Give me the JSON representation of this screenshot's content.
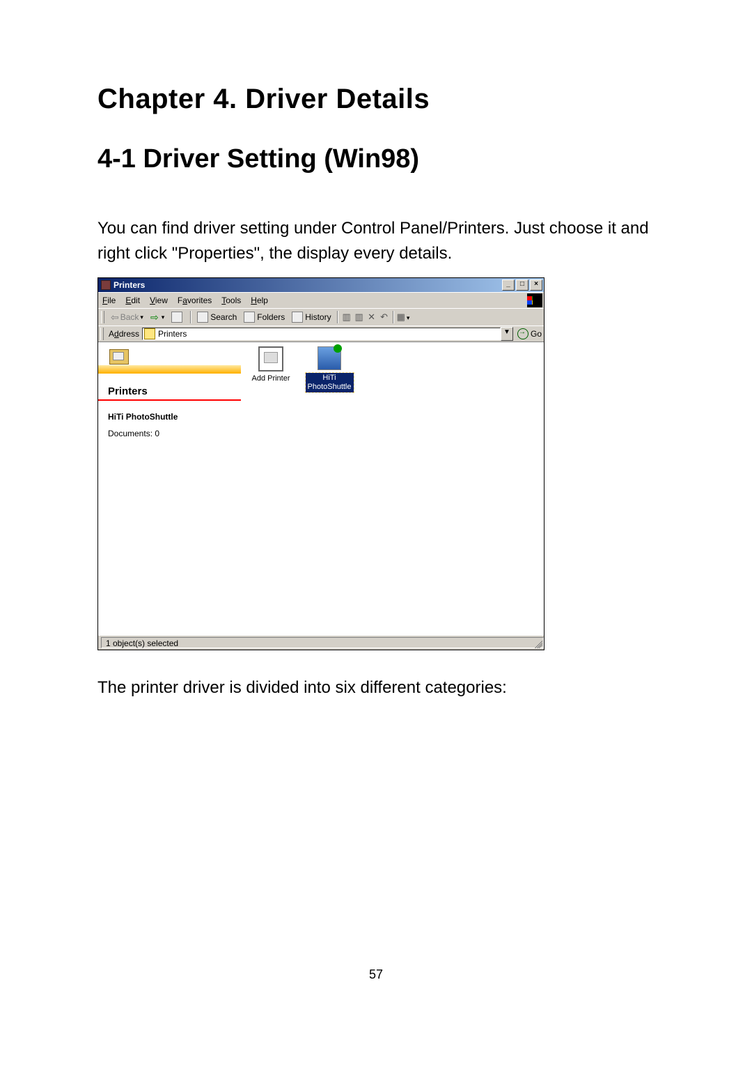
{
  "document": {
    "chapter_heading": "Chapter 4.    Driver Details",
    "section_heading": "4-1  Driver Setting (Win98)",
    "intro_text": "You can find driver setting under Control Panel/Printers. Just choose it and right click \"Properties\", the display every details.",
    "after_text": "The printer driver is divided into six different categories:",
    "page_number": "57"
  },
  "window": {
    "title": "Printers",
    "menus": {
      "file": {
        "label": "File",
        "accel": "F"
      },
      "edit": {
        "label": "Edit",
        "accel": "E"
      },
      "view": {
        "label": "View",
        "accel": "V"
      },
      "favorites": {
        "label": "Favorites",
        "accel": "a"
      },
      "tools": {
        "label": "Tools",
        "accel": "T"
      },
      "help": {
        "label": "Help",
        "accel": "H"
      }
    },
    "toolbar": {
      "back": "Back",
      "search": "Search",
      "folders": "Folders",
      "history": "History"
    },
    "address": {
      "label": "Address",
      "accel": "d",
      "value": "Printers",
      "go": "Go"
    },
    "left_pane": {
      "banner_title": "Printers",
      "selected_name": "HiTi PhotoShuttle",
      "documents": "Documents: 0"
    },
    "items": {
      "add_printer": "Add Printer",
      "printer_name": [
        "HiTi",
        "PhotoShuttle"
      ]
    },
    "status": "1 object(s) selected"
  }
}
